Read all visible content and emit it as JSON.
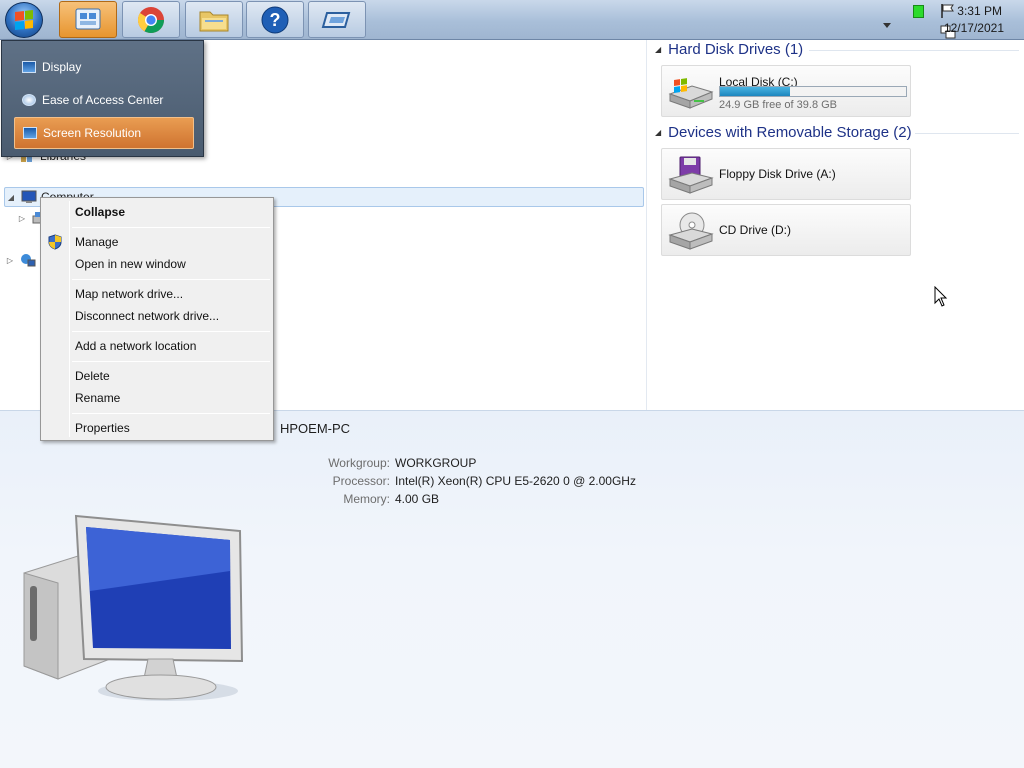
{
  "taskbar": {
    "start_button": "start-orb",
    "pinned": [
      {
        "name": "control-panel",
        "active": true
      },
      {
        "name": "chrome",
        "active": false
      },
      {
        "name": "windows-explorer",
        "active": false
      },
      {
        "name": "help-and-support",
        "active": false
      },
      {
        "name": "remote-desktop",
        "active": false
      }
    ],
    "clock": {
      "time": "3:31 PM",
      "date": "12/17/2021"
    }
  },
  "jumplist": {
    "items": [
      {
        "label": "Display",
        "icon": "display-icon",
        "highlighted": false
      },
      {
        "label": "Ease of Access Center",
        "icon": "ease-of-access-icon",
        "highlighted": false
      },
      {
        "label": "Screen Resolution",
        "icon": "screen-resolution-icon",
        "highlighted": true
      }
    ]
  },
  "navpane": {
    "libraries_label": "Libraries",
    "computer_label": "Computer"
  },
  "content": {
    "groups": [
      {
        "title": "Hard Disk Drives (1)"
      },
      {
        "title": "Devices with Removable Storage (2)"
      }
    ],
    "drives": [
      {
        "name": "Local Disk (C:)",
        "free_text": "24.9 GB free of 39.8 GB",
        "used_fraction": 0.374
      },
      {
        "name": "Floppy Disk Drive (A:)"
      },
      {
        "name": "CD Drive (D:)"
      }
    ]
  },
  "details": {
    "computer_name": "HPOEM-PC",
    "rows": [
      {
        "key": "Workgroup:",
        "value": "WORKGROUP"
      },
      {
        "key": "Processor:",
        "value": "Intel(R) Xeon(R) CPU E5-2620 0 @ 2.00GHz"
      },
      {
        "key": "Memory:",
        "value": "4.00 GB"
      }
    ]
  },
  "context_menu": {
    "items": [
      {
        "label": "Collapse",
        "bold": true
      },
      {
        "label": "Manage",
        "icon": "uac-shield-icon"
      },
      {
        "label": "Open in new window"
      },
      {
        "label": "Map network drive..."
      },
      {
        "label": "Disconnect network drive..."
      },
      {
        "label": "Add a network location"
      },
      {
        "label": "Delete"
      },
      {
        "label": "Rename"
      },
      {
        "label": "Properties"
      }
    ]
  },
  "colors": {
    "taskbar": "#b0c4dc",
    "jumplist_bg": "#55667a",
    "highlight": "#dd8540",
    "group_title": "#1e3287",
    "drive_fill": "#2a96cc"
  }
}
